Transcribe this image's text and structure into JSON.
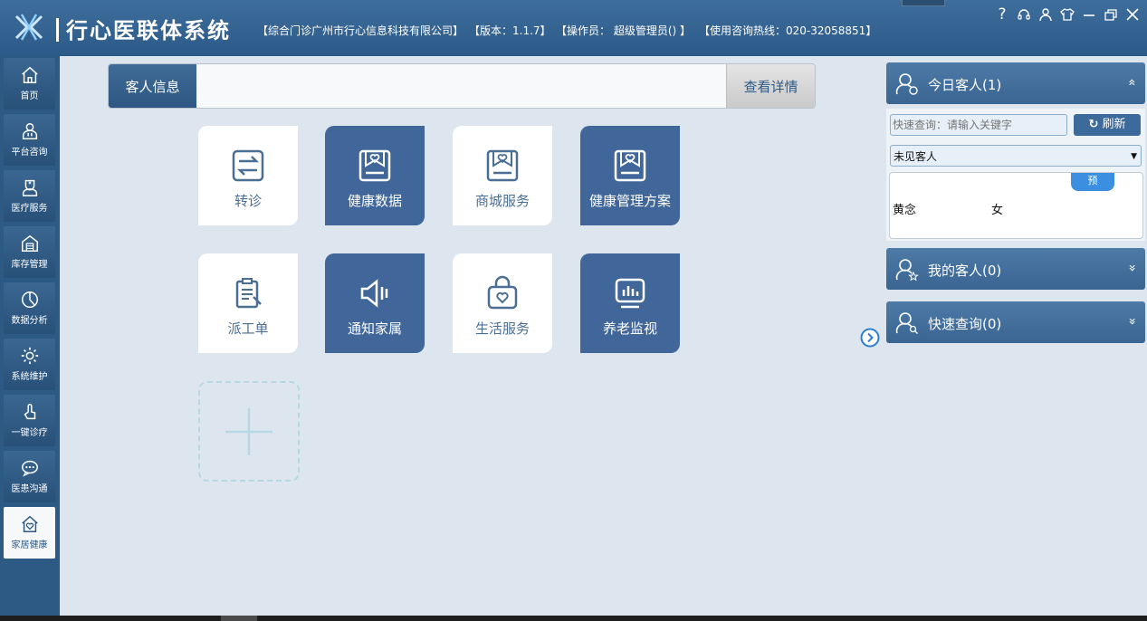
{
  "app": {
    "title": "行心医联体系统",
    "company": "【综合门诊广州市行心信息科技有限公司】",
    "version": "【版本：1.1.7】",
    "operator": "【操作员： 超级管理员() 】",
    "hotline": "【使用咨询热线：020-32058851】"
  },
  "window_controls": {
    "help": "?",
    "icons": [
      "headset-icon",
      "user-icon",
      "shirt-icon",
      "minimize-icon",
      "restore-icon",
      "close-icon"
    ]
  },
  "sidebar": {
    "items": [
      {
        "label": "首页",
        "icon": "home-icon"
      },
      {
        "label": "平台咨询",
        "icon": "doctor-icon"
      },
      {
        "label": "医疗服务",
        "icon": "nurse-icon"
      },
      {
        "label": "库存管理",
        "icon": "warehouse-icon"
      },
      {
        "label": "数据分析",
        "icon": "pie-chart-icon"
      },
      {
        "label": "系统维护",
        "icon": "settings-icon"
      },
      {
        "label": "一键诊疗",
        "icon": "touch-icon"
      },
      {
        "label": "医患沟通",
        "icon": "chat-icon"
      },
      {
        "label": "家居健康",
        "icon": "home-heart-icon",
        "active": true
      }
    ]
  },
  "customer_bar": {
    "label": "客人信息",
    "detail_button": "查看详情"
  },
  "tiles": [
    {
      "label": "转诊",
      "icon": "transfer-icon",
      "style": "light"
    },
    {
      "label": "健康数据",
      "icon": "health-data-icon",
      "style": "dark"
    },
    {
      "label": "商城服务",
      "icon": "mall-icon",
      "style": "light"
    },
    {
      "label": "健康管理方案",
      "icon": "health-plan-icon",
      "style": "dark"
    },
    {
      "label": "派工单",
      "icon": "clipboard-icon",
      "style": "light"
    },
    {
      "label": "通知家属",
      "icon": "speaker-icon",
      "style": "dark"
    },
    {
      "label": "生活服务",
      "icon": "bag-icon",
      "style": "light"
    },
    {
      "label": "养老监视",
      "icon": "monitor-icon",
      "style": "dark"
    }
  ],
  "right_panel": {
    "today": {
      "title": "今日客人(1)",
      "chevron": "»"
    },
    "search": {
      "placeholder": "快速查询：请输入关键字",
      "refresh": "刷新"
    },
    "filter": {
      "selected": "未见客人"
    },
    "customers": [
      {
        "name": "黄念",
        "sex": "女",
        "tag": "预"
      }
    ],
    "my_customers": {
      "title": "我的客人(0)",
      "chevron": "»"
    },
    "quick_query": {
      "title": "快速查询(0)",
      "chevron": "»"
    }
  },
  "colors": {
    "titlebar": "#2c5a88",
    "sidebar": "#2d5a85",
    "tile_dark": "#41679a",
    "accent": "#3c8fe0",
    "background": "#dde6ee"
  }
}
